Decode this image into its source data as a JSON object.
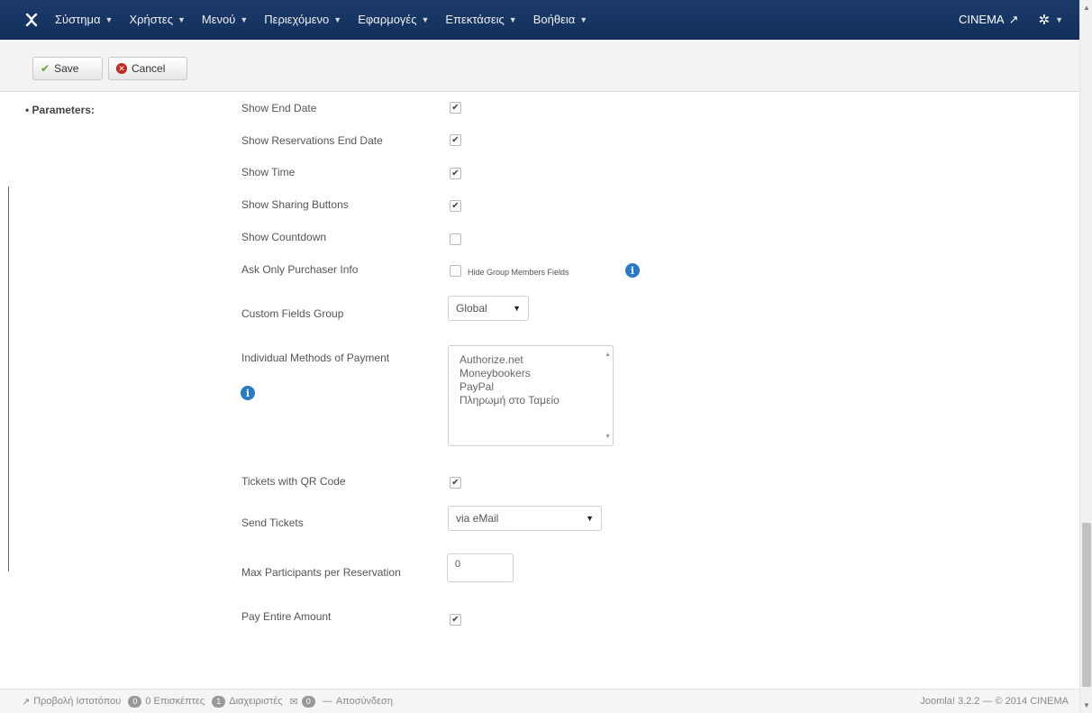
{
  "navbar": {
    "logo_icon": "joomla-logo-icon",
    "menus": [
      "Σύστημα",
      "Χρήστες",
      "Μενού",
      "Περιεχόμενο",
      "Εφαρμογές",
      "Επεκτάσεις",
      "Βοήθεια"
    ],
    "site_name": "CINEMA",
    "settings_icon": "gear-icon"
  },
  "toolbar": {
    "save_label": "Save",
    "cancel_label": "Cancel"
  },
  "form": {
    "section_heading": "Parameters:",
    "show_end_date_label": "Show End Date",
    "show_end_date_checked": true,
    "show_res_end_date_label": "Show Reservations End Date",
    "show_res_end_date_checked": true,
    "show_time_label": "Show Time",
    "show_time_checked": true,
    "show_sharing_label": "Show Sharing Buttons",
    "show_sharing_checked": true,
    "show_countdown_label": "Show Countdown",
    "show_countdown_checked": false,
    "ask_purchaser_label": "Ask Only Purchaser Info",
    "ask_purchaser_checked": false,
    "hide_group_members_label": "Hide Group Members Fields",
    "custom_fields_label": "Custom Fields Group",
    "custom_fields_value": "Global",
    "payment_methods_label": "Individual Methods of Payment",
    "payment_methods": [
      "Authorize.net",
      "Moneybookers",
      "PayPal",
      "Πληρωμή στο Ταμείο"
    ],
    "qr_code_label": "Tickets with QR Code",
    "qr_code_checked": true,
    "send_tickets_label": "Send Tickets",
    "send_tickets_value": "via eMail",
    "max_participants_label": "Max Participants per Reservation",
    "max_participants_value": "0",
    "pay_entire_label": "Pay Entire Amount",
    "pay_entire_checked": true
  },
  "footer": {
    "view_site": "Προβολή Ιστοτόπου",
    "visitors_count": "0",
    "visitors_label": "0 Επισκέπτες",
    "admins_count": "1",
    "admins_label": "Διαχειριστές",
    "messages_count": "0",
    "logout_label": "Αποσύνδεση",
    "version_text": "Joomla! 3.2.2 — © 2014 CINEMA"
  }
}
